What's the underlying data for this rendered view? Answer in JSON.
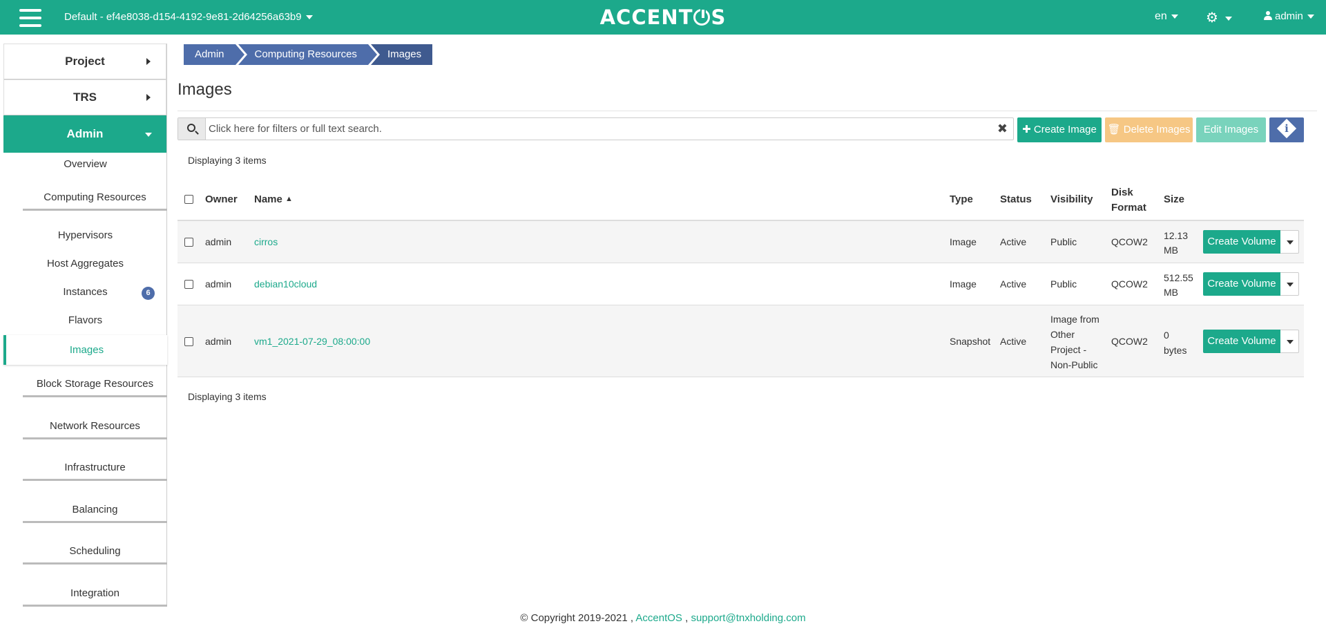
{
  "header": {
    "project": "Default - ef4e8038-d154-4192-9e81-2d64256a63b9",
    "brand_left": "ACCENT",
    "brand_right": "S",
    "language": "en",
    "user": "admin"
  },
  "sidebar": {
    "project": "Project",
    "trs": "TRS",
    "admin": "Admin",
    "items": [
      "Overview",
      "Computing Resources",
      "Hypervisors",
      "Host Aggregates",
      "Instances",
      "Flavors",
      "Images",
      "Block Storage Resources",
      "Network Resources",
      "Infrastructure",
      "Balancing",
      "Scheduling",
      "Integration"
    ],
    "instances_badge": "6"
  },
  "breadcrumb": [
    "Admin",
    "Computing Resources",
    "Images"
  ],
  "page": {
    "title": "Images",
    "search_placeholder": "Click here for filters or full text search.",
    "clear": "✖",
    "create_button": "Create Image",
    "delete_button": "Delete Images",
    "edit_button": "Edit Images",
    "info_button": "i",
    "count_top": "Displaying 3 items",
    "count_bottom": "Displaying 3 items"
  },
  "table": {
    "headers": {
      "owner": "Owner",
      "name": "Name",
      "type": "Type",
      "status": "Status",
      "visibility": "Visibility",
      "disk_format_1": "Disk",
      "disk_format_2": "Format",
      "size": "Size"
    },
    "rows": [
      {
        "owner": "admin",
        "name": "cirros",
        "type": "Image",
        "status": "Active",
        "visibility_lines": [
          "Public"
        ],
        "disk_format": "QCOW2",
        "size_lines": [
          "12.13",
          "MB"
        ],
        "action": "Create Volume"
      },
      {
        "owner": "admin",
        "name": "debian10cloud",
        "type": "Image",
        "status": "Active",
        "visibility_lines": [
          "Public"
        ],
        "disk_format": "QCOW2",
        "size_lines": [
          "512.55",
          "MB"
        ],
        "action": "Create Volume"
      },
      {
        "owner": "admin",
        "name": "vm1_2021-07-29_08:00:00",
        "type": "Snapshot",
        "status": "Active",
        "visibility_lines": [
          "Image from",
          "Other",
          "Project -",
          "Non-Public"
        ],
        "disk_format": "QCOW2",
        "size_lines": [
          "0",
          "bytes"
        ],
        "action": "Create Volume"
      }
    ]
  },
  "footer": {
    "copyright": "© Copyright 2019-2021 ,",
    "link1": "AccentOS",
    "sep": ",",
    "link2": "support@tnxholding.com"
  },
  "colors": {
    "primary": "#1ca98b",
    "secondary": "#4e6daa",
    "warning": "#f6c784"
  }
}
